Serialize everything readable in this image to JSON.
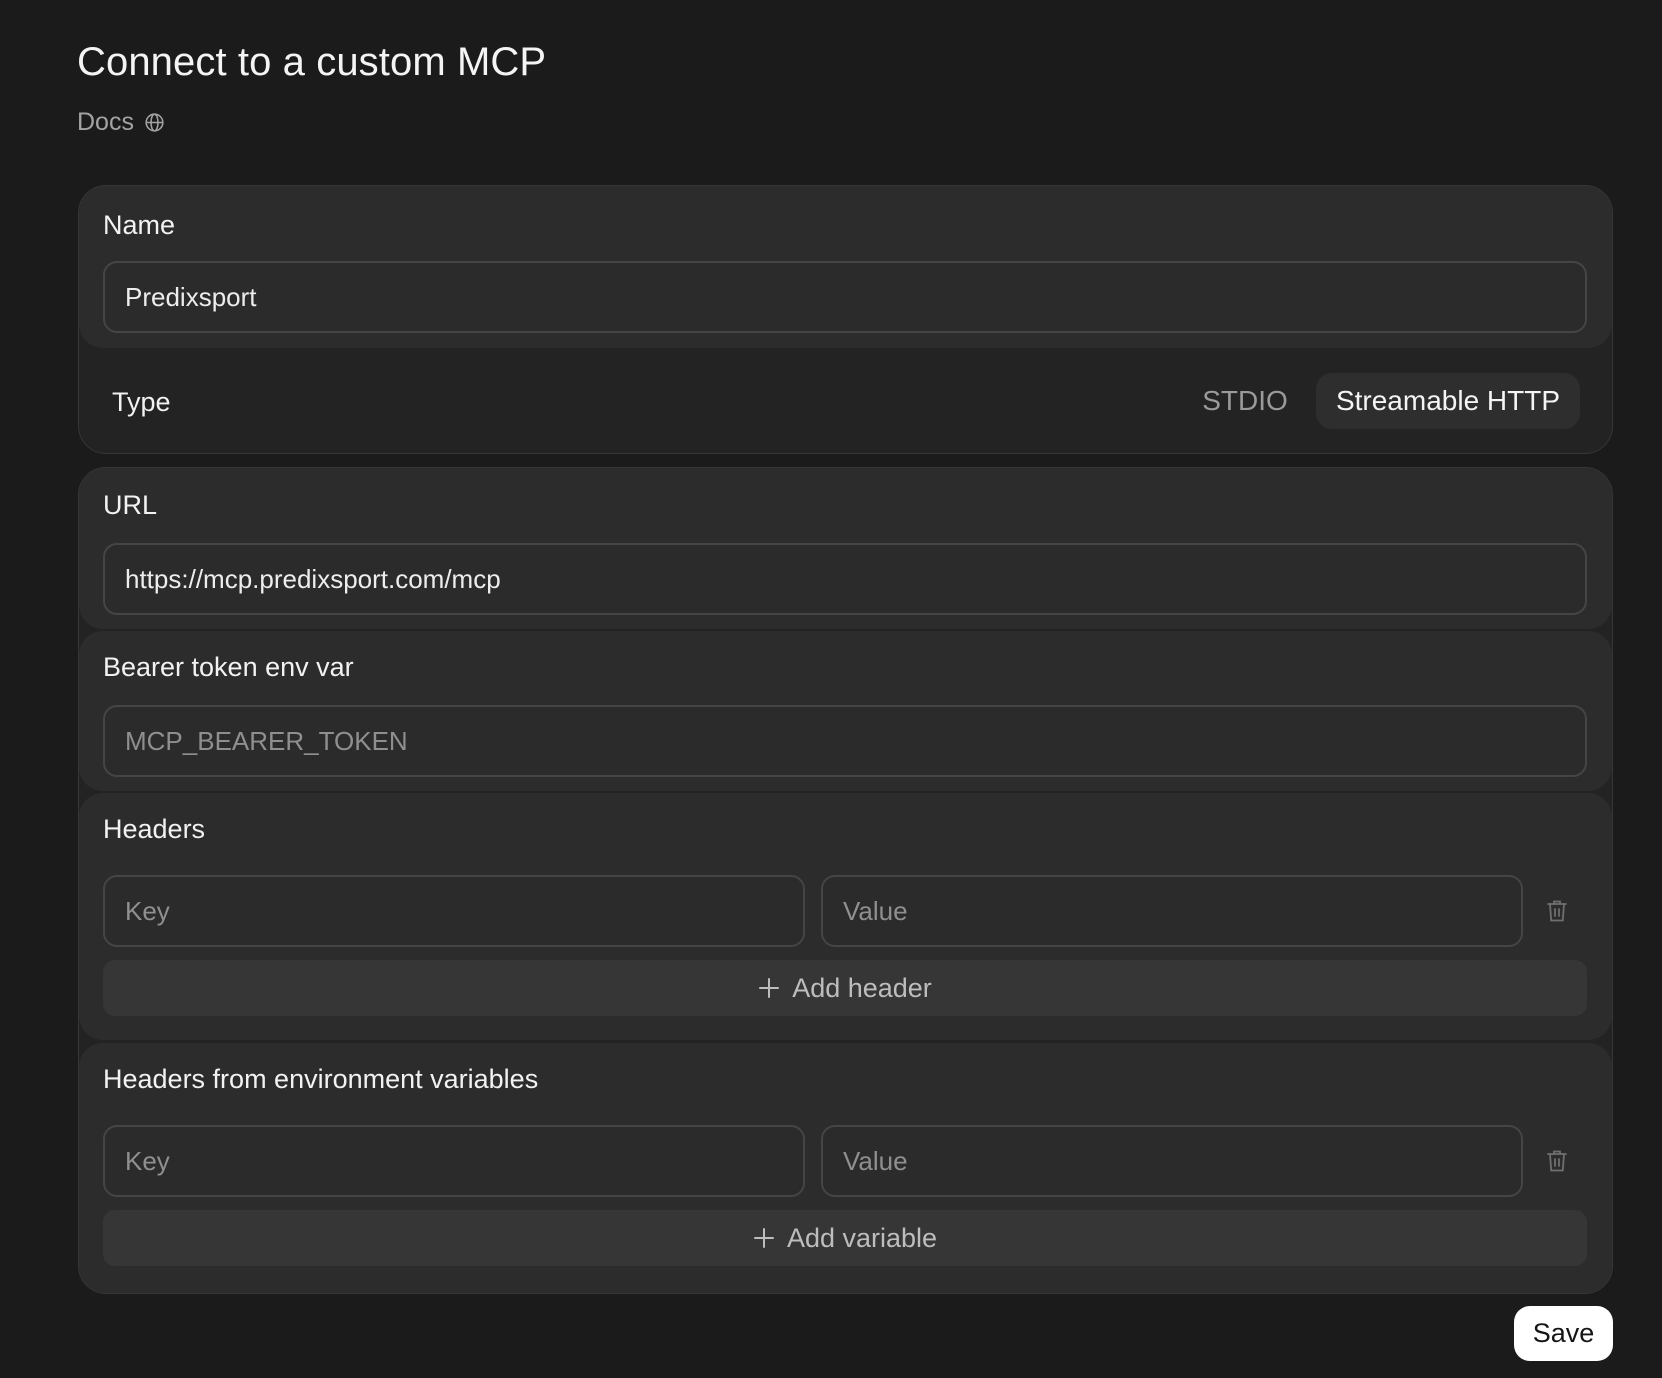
{
  "page": {
    "title": "Connect to a custom MCP",
    "docs_label": "Docs"
  },
  "name_field": {
    "label": "Name",
    "value": "Predixsport"
  },
  "type_field": {
    "label": "Type",
    "options": [
      "STDIO",
      "Streamable HTTP"
    ],
    "selected": "Streamable HTTP"
  },
  "url_field": {
    "label": "URL",
    "value": "https://mcp.predixsport.com/mcp"
  },
  "bearer_field": {
    "label": "Bearer token env var",
    "placeholder": "MCP_BEARER_TOKEN",
    "value": ""
  },
  "headers": {
    "label": "Headers",
    "key_placeholder": "Key",
    "value_placeholder": "Value",
    "add_label": "Add header"
  },
  "env_headers": {
    "label": "Headers from environment variables",
    "key_placeholder": "Key",
    "value_placeholder": "Value",
    "add_label": "Add variable"
  },
  "actions": {
    "save_label": "Save"
  },
  "icons": {
    "docs": "globe-icon",
    "delete": "trash-icon",
    "add": "plus-icon"
  },
  "colors": {
    "background": "#1b1b1b",
    "card": "#232323",
    "section": "#2c2c2c",
    "input_border": "#454545",
    "save_bg": "#ffffff"
  }
}
